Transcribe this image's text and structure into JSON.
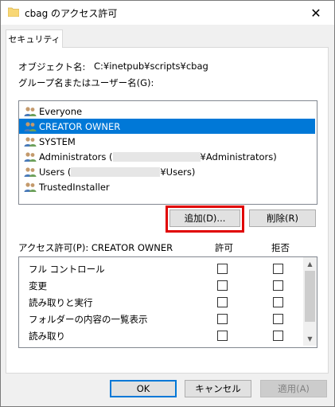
{
  "window": {
    "title": "cbag のアクセス許可",
    "close_glyph": "✕"
  },
  "tabs": [
    {
      "label": "セキュリティ"
    }
  ],
  "object": {
    "label": "オブジェクト名:",
    "value": "C:¥inetpub¥scripts¥cbag"
  },
  "groups": {
    "label": "グループ名またはユーザー名(G):",
    "items": [
      {
        "name": "Everyone",
        "selected": false
      },
      {
        "name": "CREATOR OWNER",
        "selected": true
      },
      {
        "name": "SYSTEM",
        "selected": false
      },
      {
        "name_prefix": "Administrators (",
        "name_suffix": "¥Administrators)",
        "selected": false
      },
      {
        "name_prefix": "Users (",
        "name_suffix": "¥Users)",
        "selected": false
      },
      {
        "name": "TrustedInstaller",
        "selected": false
      }
    ]
  },
  "buttons": {
    "add": "追加(D)...",
    "remove": "削除(R)",
    "ok": "OK",
    "cancel": "キャンセル",
    "apply": "適用(A)"
  },
  "permissions": {
    "label": "アクセス許可(P): CREATOR OWNER",
    "allow_header": "許可",
    "deny_header": "拒否",
    "rows": [
      {
        "name": "フル コントロール",
        "allow": false,
        "deny": false
      },
      {
        "name": "変更",
        "allow": false,
        "deny": false
      },
      {
        "name": "読み取りと実行",
        "allow": false,
        "deny": false
      },
      {
        "name": "フォルダーの内容の一覧表示",
        "allow": false,
        "deny": false
      },
      {
        "name": "読み取り",
        "allow": false,
        "deny": false
      }
    ]
  },
  "colors": {
    "selection": "#0078d7",
    "highlight_outline": "#e00000"
  },
  "icons": [
    "folder-icon",
    "close-icon",
    "users-icon",
    "chevron-up-icon",
    "chevron-down-icon"
  ]
}
